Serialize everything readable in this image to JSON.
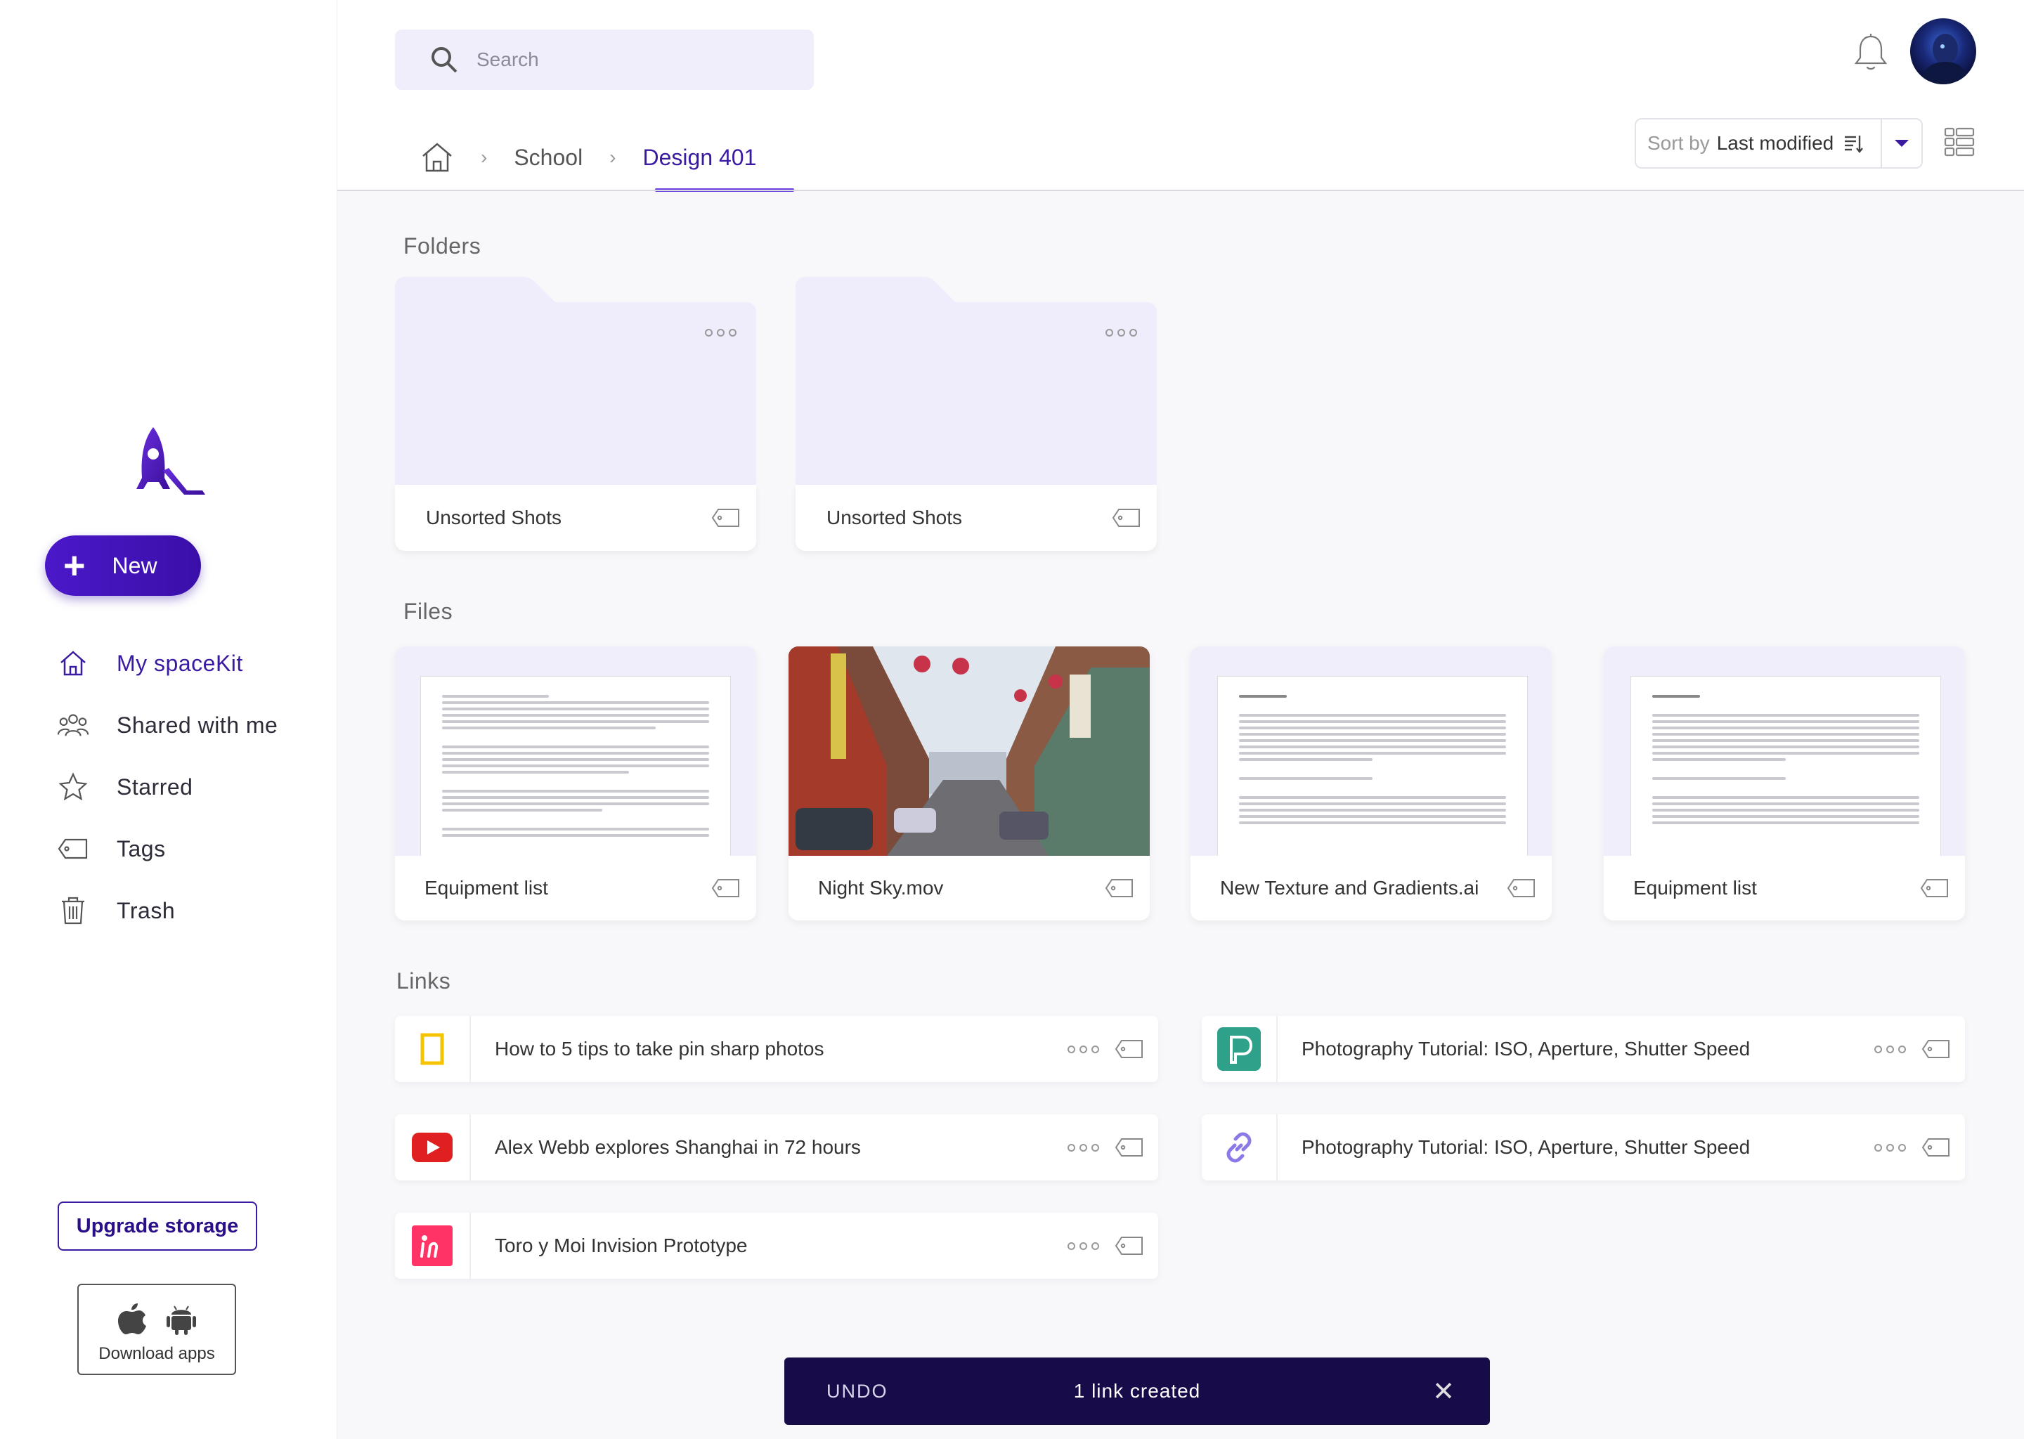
{
  "search": {
    "placeholder": "Search"
  },
  "sidebar": {
    "new_label": "New",
    "items": [
      {
        "label": "My spaceKit",
        "icon": "home-icon"
      },
      {
        "label": "Shared with me",
        "icon": "people-icon"
      },
      {
        "label": "Starred",
        "icon": "star-icon"
      },
      {
        "label": "Tags",
        "icon": "tag-icon"
      },
      {
        "label": "Trash",
        "icon": "trash-icon"
      }
    ],
    "upgrade_label": "Upgrade storage",
    "download_label": "Download apps"
  },
  "breadcrumb": {
    "items": [
      "School",
      "Design 401"
    ]
  },
  "sort": {
    "prefix": "Sort by",
    "value": "Last modified"
  },
  "sections": {
    "folders": "Folders",
    "files": "Files",
    "links": "Links"
  },
  "folders": [
    {
      "name": "Unsorted Shots"
    },
    {
      "name": "Unsorted Shots"
    }
  ],
  "files": [
    {
      "name": "Equipment list",
      "type": "document"
    },
    {
      "name": "Night Sky.mov",
      "type": "image"
    },
    {
      "name": "New Texture and Gradients.ai",
      "type": "document"
    },
    {
      "name": "Equipment list",
      "type": "document"
    }
  ],
  "links": [
    {
      "title": "How to 5 tips to take pin sharp photos",
      "icon": "national-geographic-icon"
    },
    {
      "title": "Photography Tutorial: ISO, Aperture, Shutter Speed",
      "icon": "p-app-icon"
    },
    {
      "title": "Alex Webb explores Shanghai in 72 hours",
      "icon": "youtube-icon"
    },
    {
      "title": "Photography Tutorial: ISO, Aperture, Shutter Speed",
      "icon": "chain-link-icon"
    },
    {
      "title": "Toro y Moi Invision Prototype",
      "icon": "invision-icon"
    }
  ],
  "snackbar": {
    "action": "UNDO",
    "message": "1 link created"
  },
  "colors": {
    "accent": "#3a1aa0",
    "snackbar_bg": "#170b4a",
    "folder_bg": "#f1eefc"
  }
}
